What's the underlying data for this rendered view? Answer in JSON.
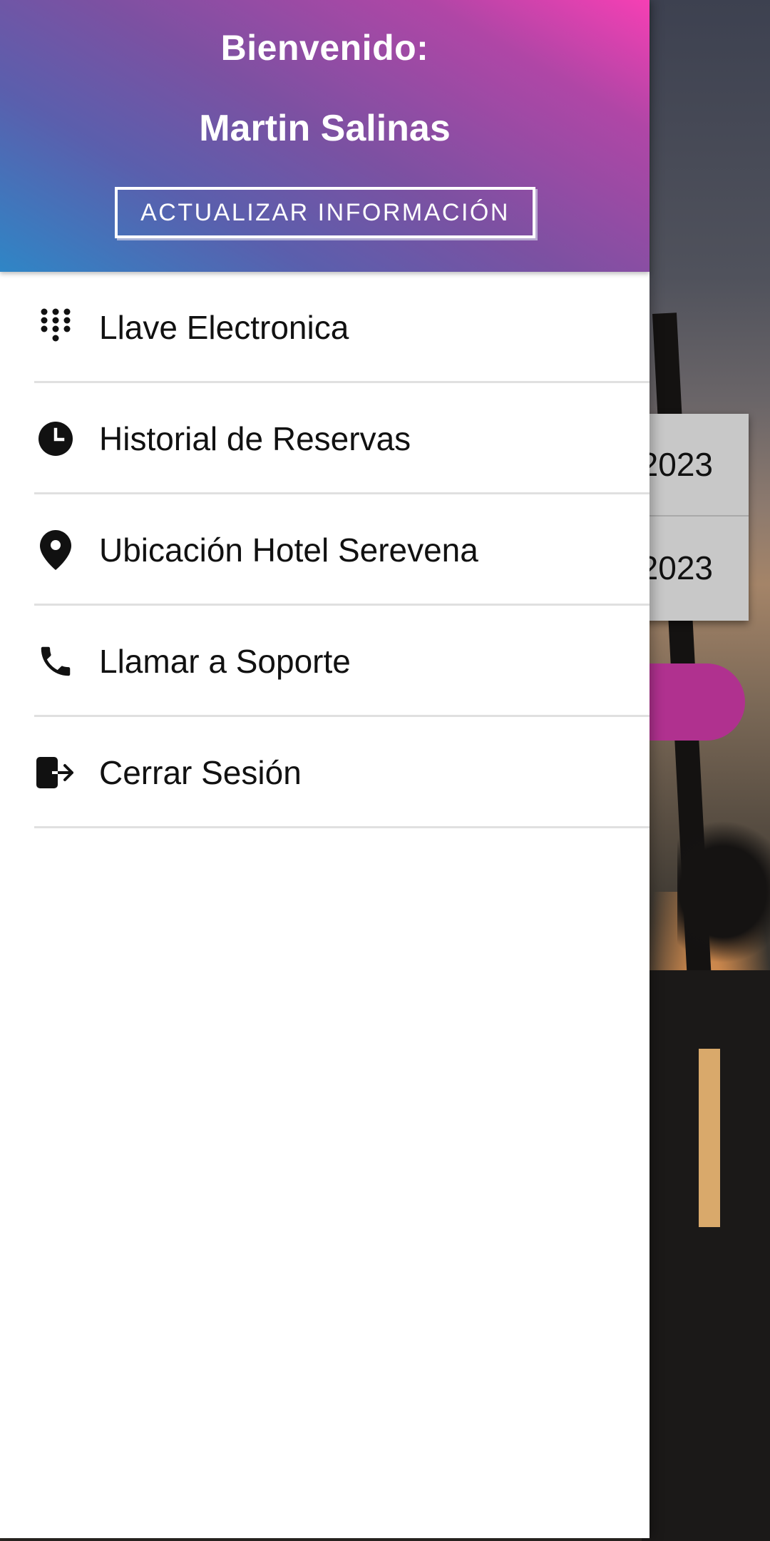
{
  "drawer": {
    "welcome_text": "Bienvenido:",
    "user_name": "Martin Salinas",
    "update_button_label": "ACTUALIZAR INFORMACIÓN",
    "menu_items": [
      {
        "label": "Llave Electronica",
        "icon": "dialpad-icon"
      },
      {
        "label": "Historial de Reservas",
        "icon": "clock-icon"
      },
      {
        "label": "Ubicación Hotel Serevena",
        "icon": "location-pin-icon"
      },
      {
        "label": "Llamar a Soporte",
        "icon": "phone-icon"
      },
      {
        "label": "Cerrar Sesión",
        "icon": "logout-icon"
      }
    ],
    "header_gradient": [
      "#2f86c6",
      "#7b51a2",
      "#f63fb4"
    ]
  },
  "background_app": {
    "reservation_rows": [
      "2023",
      "2023"
    ],
    "accent_color": "#b0318f"
  }
}
